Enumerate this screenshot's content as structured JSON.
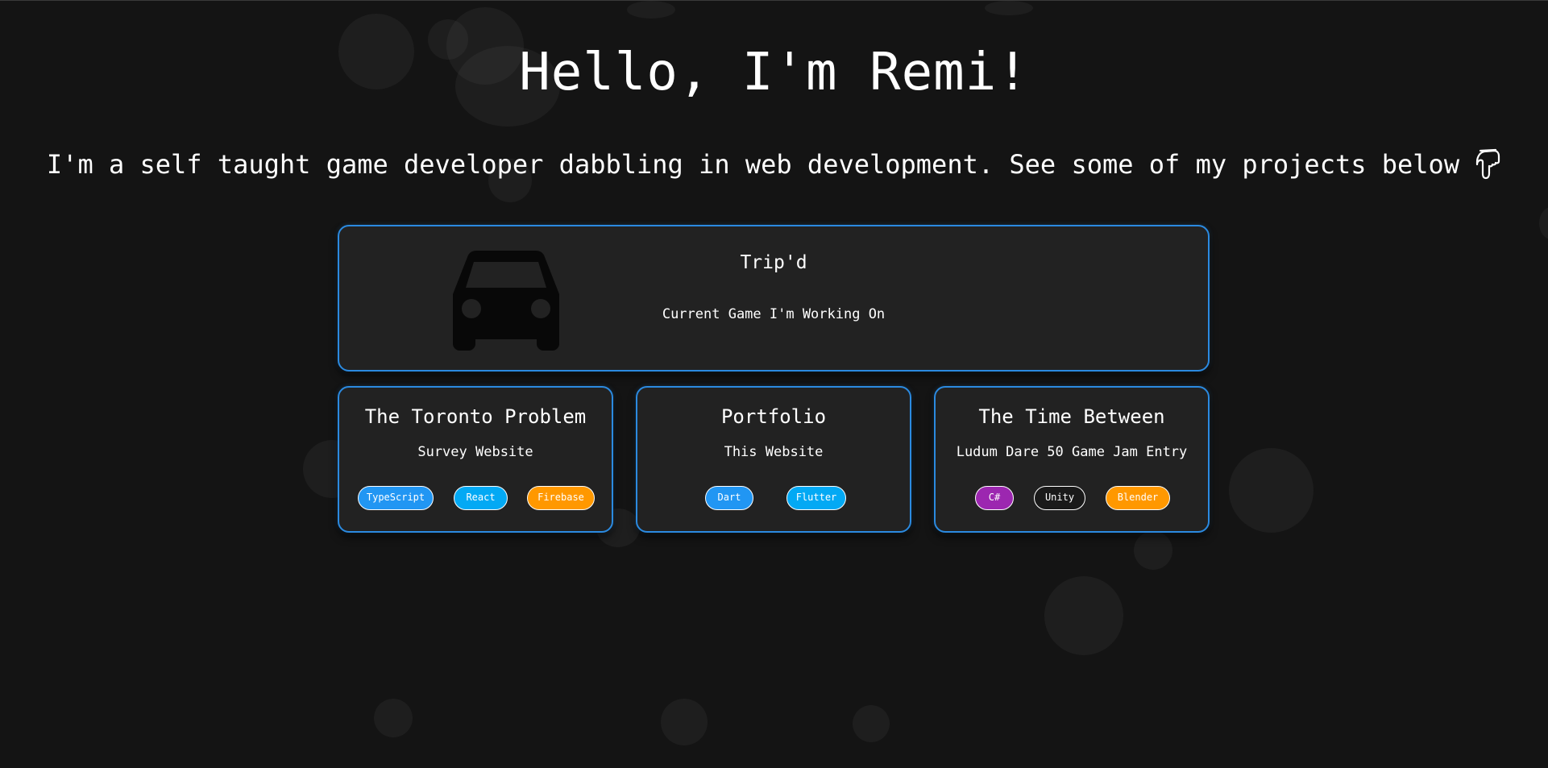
{
  "header": {
    "title": "Hello, I'm Remi!",
    "subtitle": "I'm a self taught game developer dabbling in web development. See some of my projects below",
    "subtitle_icon": "pointing-down-hand-icon"
  },
  "featured_project": {
    "title": "Trip'd",
    "description": "Current Game I'm Working On",
    "icon": "car-icon"
  },
  "projects": [
    {
      "title": "The Toronto Problem",
      "description": "Survey Website",
      "tags": [
        {
          "label": "TypeScript",
          "color": "#2196f3"
        },
        {
          "label": "React",
          "color": "#03a9f4"
        },
        {
          "label": "Firebase",
          "color": "#ff9800"
        }
      ]
    },
    {
      "title": "Portfolio",
      "description": "This Website",
      "tags": [
        {
          "label": "Dart",
          "color": "#2196f3"
        },
        {
          "label": "Flutter",
          "color": "#03a9f4"
        }
      ]
    },
    {
      "title": "The Time Between",
      "description": "Ludum Dare 50 Game Jam Entry",
      "tags": [
        {
          "label": "C#",
          "color": "#9c27b0"
        },
        {
          "label": "Unity",
          "color": "#1a1a1a"
        },
        {
          "label": "Blender",
          "color": "#ff9800"
        }
      ]
    }
  ],
  "colors": {
    "background": "#141414",
    "card_background": "#222222",
    "card_border": "#2b8ae0"
  }
}
